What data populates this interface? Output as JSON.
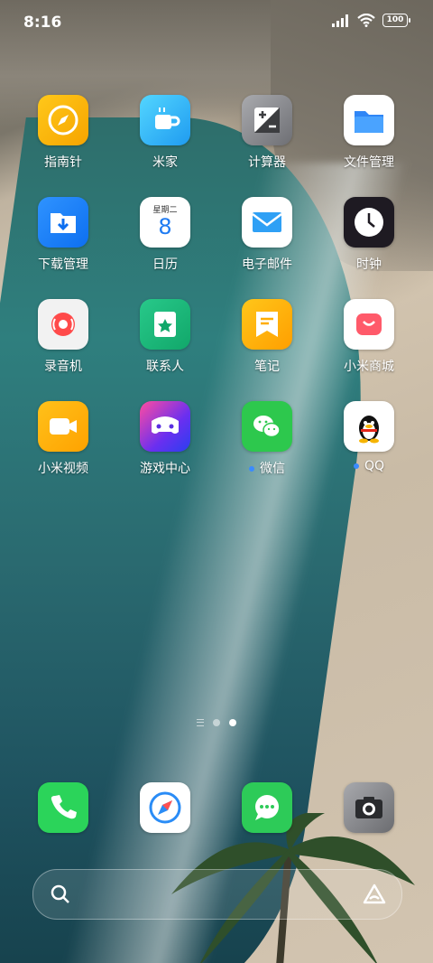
{
  "status_bar": {
    "time": "8:16",
    "battery": "100"
  },
  "apps": [
    {
      "label": "指南针",
      "icon": "compass-icon",
      "dot": false
    },
    {
      "label": "米家",
      "icon": "mijia-cup-icon",
      "dot": false
    },
    {
      "label": "计算器",
      "icon": "calculator-icon",
      "dot": false
    },
    {
      "label": "文件管理",
      "icon": "folder-icon",
      "dot": false
    },
    {
      "label": "下载管理",
      "icon": "download-icon",
      "dot": false
    },
    {
      "label": "日历",
      "icon": "calendar-icon",
      "dot": false,
      "calendar_header": "星期二",
      "calendar_day": "8"
    },
    {
      "label": "电子邮件",
      "icon": "mail-icon",
      "dot": false
    },
    {
      "label": "时钟",
      "icon": "clock-icon",
      "dot": false
    },
    {
      "label": "录音机",
      "icon": "recorder-icon",
      "dot": false
    },
    {
      "label": "联系人",
      "icon": "contacts-icon",
      "dot": false
    },
    {
      "label": "笔记",
      "icon": "notes-icon",
      "dot": false
    },
    {
      "label": "小米商城",
      "icon": "mi-store-icon",
      "dot": false
    },
    {
      "label": "小米视频",
      "icon": "video-icon",
      "dot": false
    },
    {
      "label": "游戏中心",
      "icon": "game-center-icon",
      "dot": false
    },
    {
      "label": "微信",
      "icon": "wechat-icon",
      "dot": true
    },
    {
      "label": "QQ",
      "icon": "qq-penguin-icon",
      "dot": true
    }
  ],
  "dock": [
    {
      "icon": "phone-icon"
    },
    {
      "icon": "browser-icon"
    },
    {
      "icon": "messages-icon"
    },
    {
      "icon": "camera-icon"
    }
  ],
  "search_bar": {
    "left_icon": "search-icon",
    "right_icon": "assistant-icon"
  },
  "pager": {
    "pages": 2,
    "active": 2
  }
}
